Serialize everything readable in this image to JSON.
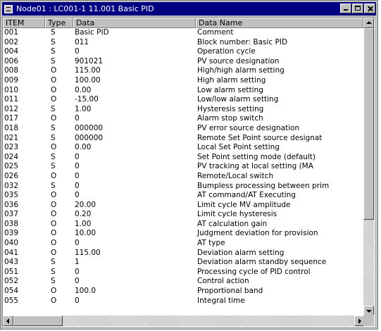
{
  "window": {
    "title": "Node01 : LC001-1 11.001 Basic PID",
    "icon": "grid-window-icon"
  },
  "table": {
    "headers": {
      "item": "ITEM",
      "type": "Type",
      "data": "Data",
      "name": "Data Name"
    },
    "rows": [
      {
        "item": "001",
        "type": "S",
        "data": "Basic PID",
        "name": "Comment"
      },
      {
        "item": "002",
        "type": "S",
        "data": "011",
        "name": "Block number: Basic PID"
      },
      {
        "item": "004",
        "type": "S",
        "data": "0",
        "name": "Operation cycle"
      },
      {
        "item": "006",
        "type": "S",
        "data": "901021",
        "name": "PV source designation"
      },
      {
        "item": "008",
        "type": "O",
        "data": "115.00",
        "name": "High/high alarm setting"
      },
      {
        "item": "009",
        "type": "O",
        "data": "100.00",
        "name": "High alarm setting"
      },
      {
        "item": "010",
        "type": "O",
        "data": "0.00",
        "name": "Low alarm setting"
      },
      {
        "item": "011",
        "type": "O",
        "data": "-15.00",
        "name": "Low/low alarm setting"
      },
      {
        "item": "012",
        "type": "S",
        "data": "1.00",
        "name": "Hysteresis setting"
      },
      {
        "item": "017",
        "type": "O",
        "data": "0",
        "name": "Alarm stop switch"
      },
      {
        "item": "018",
        "type": "S",
        "data": "000000",
        "name": "PV error source designation"
      },
      {
        "item": "021",
        "type": "S",
        "data": "000000",
        "name": "Remote Set Point source designat"
      },
      {
        "item": "023",
        "type": "O",
        "data": "0.00",
        "name": "Local Set Point setting"
      },
      {
        "item": "024",
        "type": "S",
        "data": "0",
        "name": "Set Point setting mode (default)"
      },
      {
        "item": "025",
        "type": "S",
        "data": "0",
        "name": "PV tracking at local setting (MA"
      },
      {
        "item": "026",
        "type": "O",
        "data": "0",
        "name": "Remote/Local switch"
      },
      {
        "item": "032",
        "type": "S",
        "data": "0",
        "name": "Bumpless processing between prim"
      },
      {
        "item": "035",
        "type": "O",
        "data": "0",
        "name": "AT command/AT Executing"
      },
      {
        "item": "036",
        "type": "O",
        "data": "20.00",
        "name": "Limit cycle MV amplitude"
      },
      {
        "item": "037",
        "type": "O",
        "data": "0.20",
        "name": "Limit cycle hysteresis"
      },
      {
        "item": "038",
        "type": "O",
        "data": "1.00",
        "name": "AT calculation gain"
      },
      {
        "item": "039",
        "type": "O",
        "data": "10.00",
        "name": "Judgment deviation for provision"
      },
      {
        "item": "040",
        "type": "O",
        "data": "0",
        "name": "AT type"
      },
      {
        "item": "041",
        "type": "O",
        "data": "115.00",
        "name": "Deviation alarm setting"
      },
      {
        "item": "043",
        "type": "S",
        "data": "1",
        "name": "Deviation alarm standby sequence"
      },
      {
        "item": "051",
        "type": "S",
        "data": "0",
        "name": "Processing cycle of PID control"
      },
      {
        "item": "052",
        "type": "S",
        "data": "0",
        "name": "Control action"
      },
      {
        "item": "054",
        "type": "O",
        "data": "100.0",
        "name": "Proportional band"
      },
      {
        "item": "055",
        "type": "O",
        "data": "0",
        "name": "Integral time"
      }
    ]
  },
  "scrollbars": {
    "vertical": {
      "up_icon": "arrow-up-icon",
      "down_icon": "arrow-down-icon"
    },
    "horizontal": {
      "left_icon": "arrow-left-icon",
      "right_icon": "arrow-right-icon"
    }
  }
}
